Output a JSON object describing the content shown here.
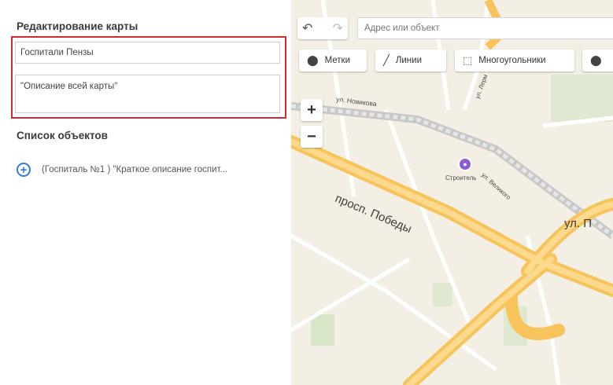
{
  "left_panel": {
    "title": "Редактирование карты",
    "map_name_value": "Госпитали Пензы",
    "map_description_value": "\"Описание всей карты\"",
    "objects_title": "Список объектов",
    "objects": [
      {
        "label": "(Госпиталь №1 ) \"Краткое описание госпит..."
      }
    ]
  },
  "map": {
    "search_placeholder": "Адрес или объект",
    "tools": {
      "marks": "Метки",
      "lines": "Линии",
      "polygons": "Многоугольники"
    },
    "zoom_in": "+",
    "zoom_out": "−",
    "labels": {
      "prospekt_pobedy": "просп. Победы",
      "ul_p": "ул. П",
      "novikova": "ул. Новикова",
      "stroitel": "Строитель",
      "velikogo": "ул. Великого",
      "lermontova": "ул. Лерм"
    }
  },
  "colors": {
    "highlight": "#d62a2a",
    "accent": "#2f7fd6",
    "road_major": "#f7c35a",
    "poi": "#8e5bd6"
  }
}
